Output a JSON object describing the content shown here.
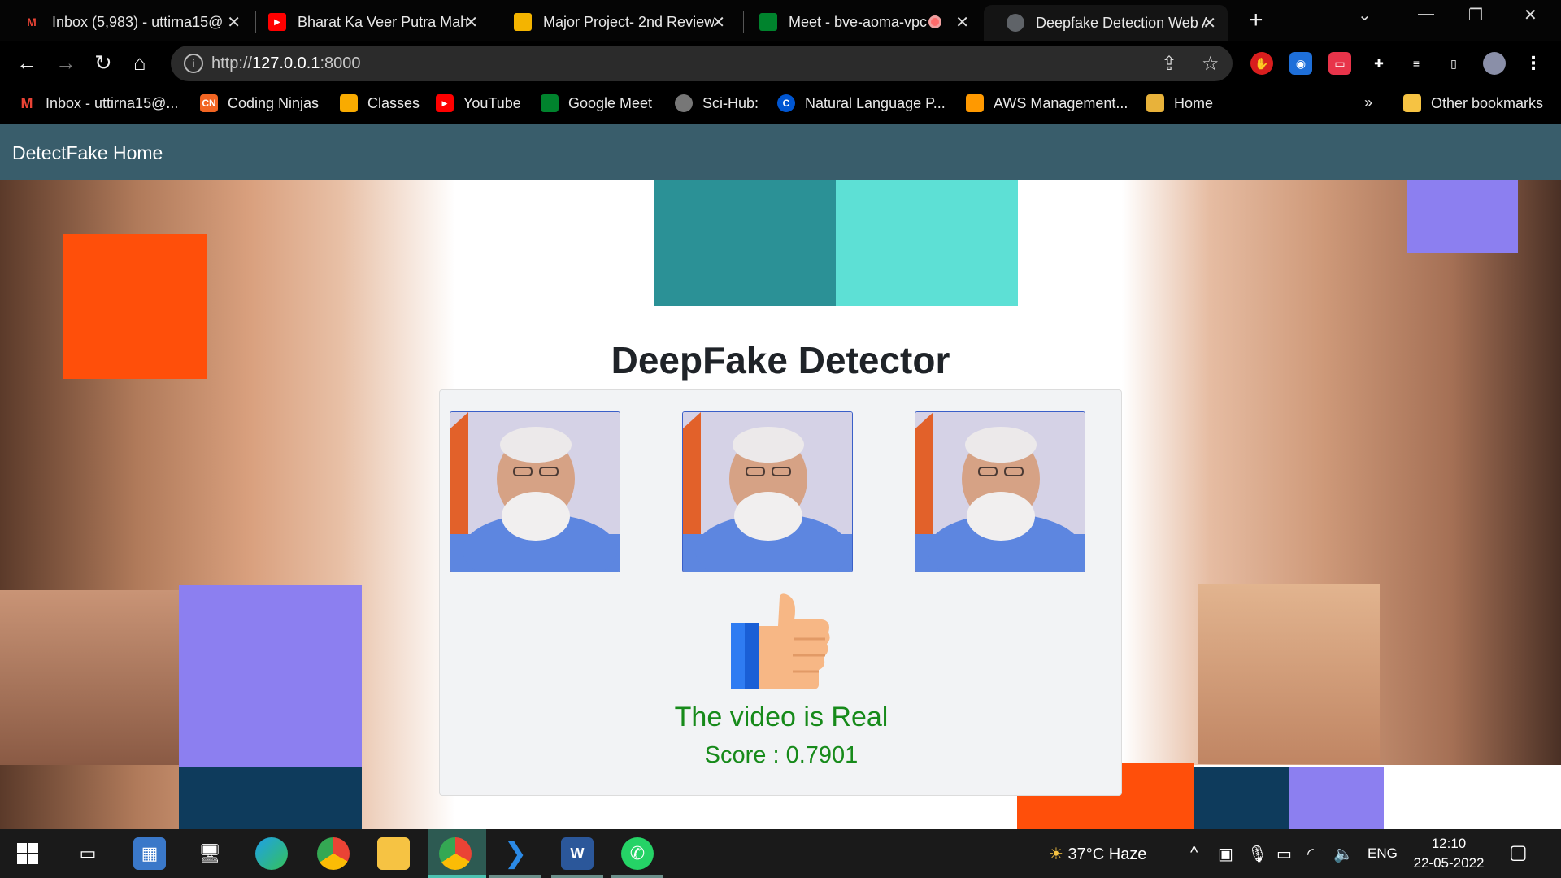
{
  "browser": {
    "tabs": [
      {
        "title": "Inbox (5,983) - uttirna15@",
        "icon": "gmail-icon"
      },
      {
        "title": "Bharat Ka Veer Putra Mah",
        "icon": "youtube-icon"
      },
      {
        "title": "Major Project- 2nd Review",
        "icon": "slides-icon"
      },
      {
        "title": "Meet - bve-aoma-vpc",
        "icon": "meet-icon"
      },
      {
        "title": "Deepfake Detection Web A",
        "icon": "globe-icon"
      }
    ],
    "url_prefix": "http://",
    "url_host": "127.0.0.1",
    "url_port": ":8000",
    "bookmarks": [
      {
        "label": "Inbox - uttirna15@...",
        "icon": "gmail-icon"
      },
      {
        "label": "Coding Ninjas",
        "icon": "coding-ninjas-icon"
      },
      {
        "label": "Classes",
        "icon": "classroom-icon"
      },
      {
        "label": "YouTube",
        "icon": "youtube-icon"
      },
      {
        "label": "Google Meet",
        "icon": "meet-icon"
      },
      {
        "label": "Sci-Hub:",
        "icon": "scihub-icon"
      },
      {
        "label": "Natural Language P...",
        "icon": "coursera-icon"
      },
      {
        "label": "AWS Management...",
        "icon": "aws-icon"
      },
      {
        "label": "Home",
        "icon": "home-box-icon"
      }
    ],
    "bookmarks_overflow": "»",
    "other_bookmarks": "Other bookmarks"
  },
  "app": {
    "brand": "DetectFake Home",
    "title_bold": "DeepFake",
    "title_rest": " Detector",
    "verdict": "The video is Real",
    "score_label": "Score : 0.7901",
    "colors": {
      "navbar": "#395d6b",
      "verdict": "#178a1a",
      "teal_dark": "#2b9196",
      "teal_light": "#5de0d5",
      "orange": "#ff4f0a",
      "purple": "#8c7ff0",
      "navy": "#0e3b5c"
    }
  },
  "taskbar": {
    "weather": "37°C  Haze",
    "language": "ENG",
    "time": "12:10",
    "date": "22-05-2022"
  }
}
